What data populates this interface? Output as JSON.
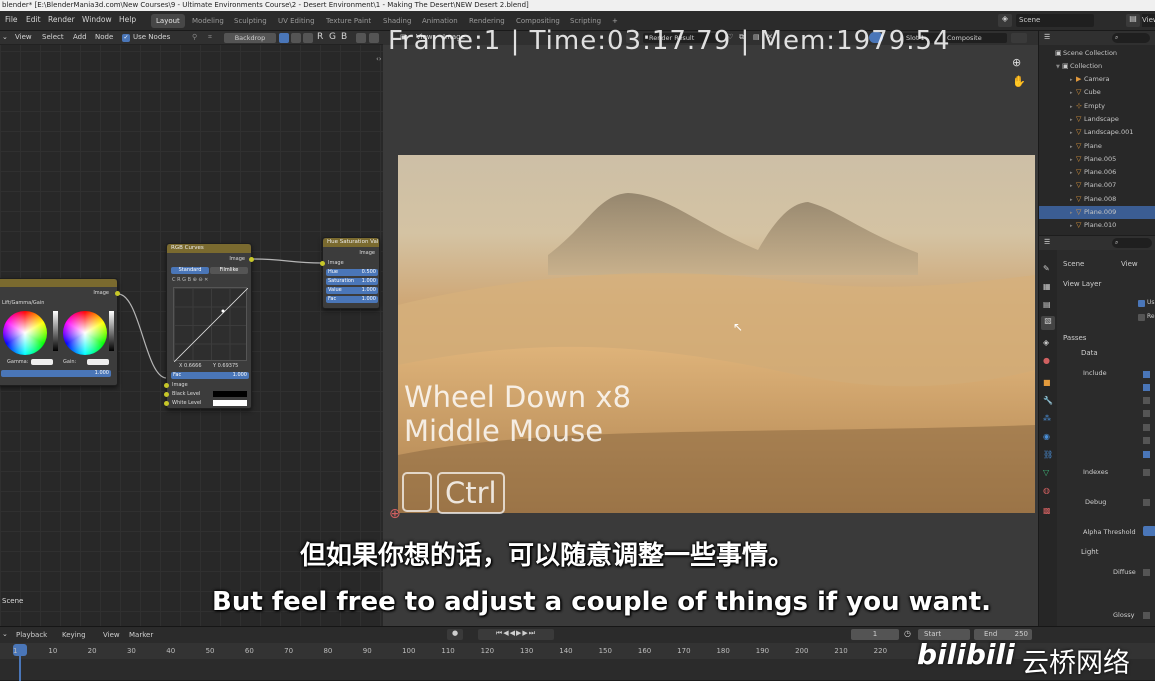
{
  "window": {
    "title": "blender* [E:\\BlenderMania3d.com\\New Courses\\9 - Ultimate Environments Course\\2 - Desert Environment\\1 - Making The Desert\\NEW Desert 2.blend]"
  },
  "menu": {
    "items": [
      "File",
      "Edit",
      "Render",
      "Window",
      "Help"
    ]
  },
  "workspaces": [
    "Layout",
    "Modeling",
    "Sculpting",
    "UV Editing",
    "Texture Paint",
    "Shading",
    "Animation",
    "Rendering",
    "Compositing",
    "Scripting"
  ],
  "active_workspace": "Layout",
  "scene": {
    "label": "Scene",
    "view_layer_label": "View Layer"
  },
  "node_editor": {
    "header_items": [
      "View",
      "Select",
      "Add",
      "Node"
    ],
    "use_nodes_label": "Use Nodes",
    "backdrop_label": "Backdrop",
    "channel_buttons": [
      "R",
      "G",
      "B"
    ],
    "scene_label": "Scene",
    "nodes": {
      "color_balance": {
        "output_label": "Image",
        "mode": "Lift/Gamma/Gain",
        "gamma_label": "Gamma:",
        "gain_label": "Gain:",
        "fac_value": "1.000"
      },
      "rgb_curves": {
        "title": "RGB Curves",
        "output_label": "Image",
        "tab_standard": "Standard",
        "tab_filmlike": "Filmlike",
        "x_val": "X 0.6666",
        "y_val": "Y 0.69375",
        "fac_label": "Fac",
        "fac_value": "1.000",
        "inputs": [
          "Image",
          "Black Level",
          "White Level"
        ]
      },
      "hue_sat": {
        "title": "Hue Saturation Val",
        "output_label": "Image",
        "input_image": "Image",
        "fields": [
          {
            "label": "Hue",
            "value": "0.500"
          },
          {
            "label": "Saturation",
            "value": "1.000"
          },
          {
            "label": "Value",
            "value": "1.000"
          },
          {
            "label": "Fac",
            "value": "1.000"
          }
        ]
      }
    }
  },
  "image_editor": {
    "header_items": [
      "View",
      "Image"
    ],
    "image_name": "Render Result",
    "slot": "Slot 1",
    "pass": "Composite",
    "stats_overlay": "Frame:1 | Time:03:17.79 | Mem:1979.54"
  },
  "key_overlay": {
    "line1": "Wheel Down x8",
    "line2": "Middle Mouse",
    "modifier": "Ctrl"
  },
  "subtitles": {
    "chinese": "但如果你想的话，可以随意调整一些事情。",
    "english": "But feel free to adjust a couple of things if you want."
  },
  "outliner": {
    "root": "Scene Collection",
    "collection": "Collection",
    "items": [
      "Camera",
      "Cube",
      "Empty",
      "Landscape",
      "Landscape.001",
      "Plane",
      "Plane.005",
      "Plane.006",
      "Plane.007",
      "Plane.008",
      "Plane.009",
      "Plane.010"
    ],
    "selected": "Plane.009"
  },
  "properties": {
    "scene_tab": "Scene",
    "view_tab": "View",
    "panel_view_layer": "View Layer",
    "panel_passes": "Passes",
    "panel_data": "Data",
    "include_label": "Include",
    "indexes_label": "Indexes",
    "debug_label": "Debug",
    "alpha_threshold_label": "Alpha Threshold",
    "panel_light": "Light",
    "diffuse_label": "Diffuse",
    "glossy_label": "Glossy",
    "view_layer_checks": [
      "Us",
      "Re"
    ]
  },
  "timeline": {
    "playback_label": "Playback",
    "keying_label": "Keying",
    "view_label": "View",
    "marker_label": "Marker",
    "current_frame": "1",
    "start_label": "Start",
    "end_label": "End",
    "end_value": "250",
    "ruler": [
      "1",
      "10",
      "20",
      "30",
      "40",
      "50",
      "60",
      "70",
      "80",
      "90",
      "100",
      "110",
      "120",
      "130",
      "140",
      "150",
      "160",
      "170",
      "180",
      "190",
      "200",
      "210",
      "220"
    ]
  },
  "watermark": {
    "brand": "bilibili",
    "channel": "云桥网络"
  },
  "colors": {
    "accent": "#4a76b8",
    "selection": "#3b5d93",
    "node_header": "#7a6a2f",
    "socket": "#c7c729"
  }
}
